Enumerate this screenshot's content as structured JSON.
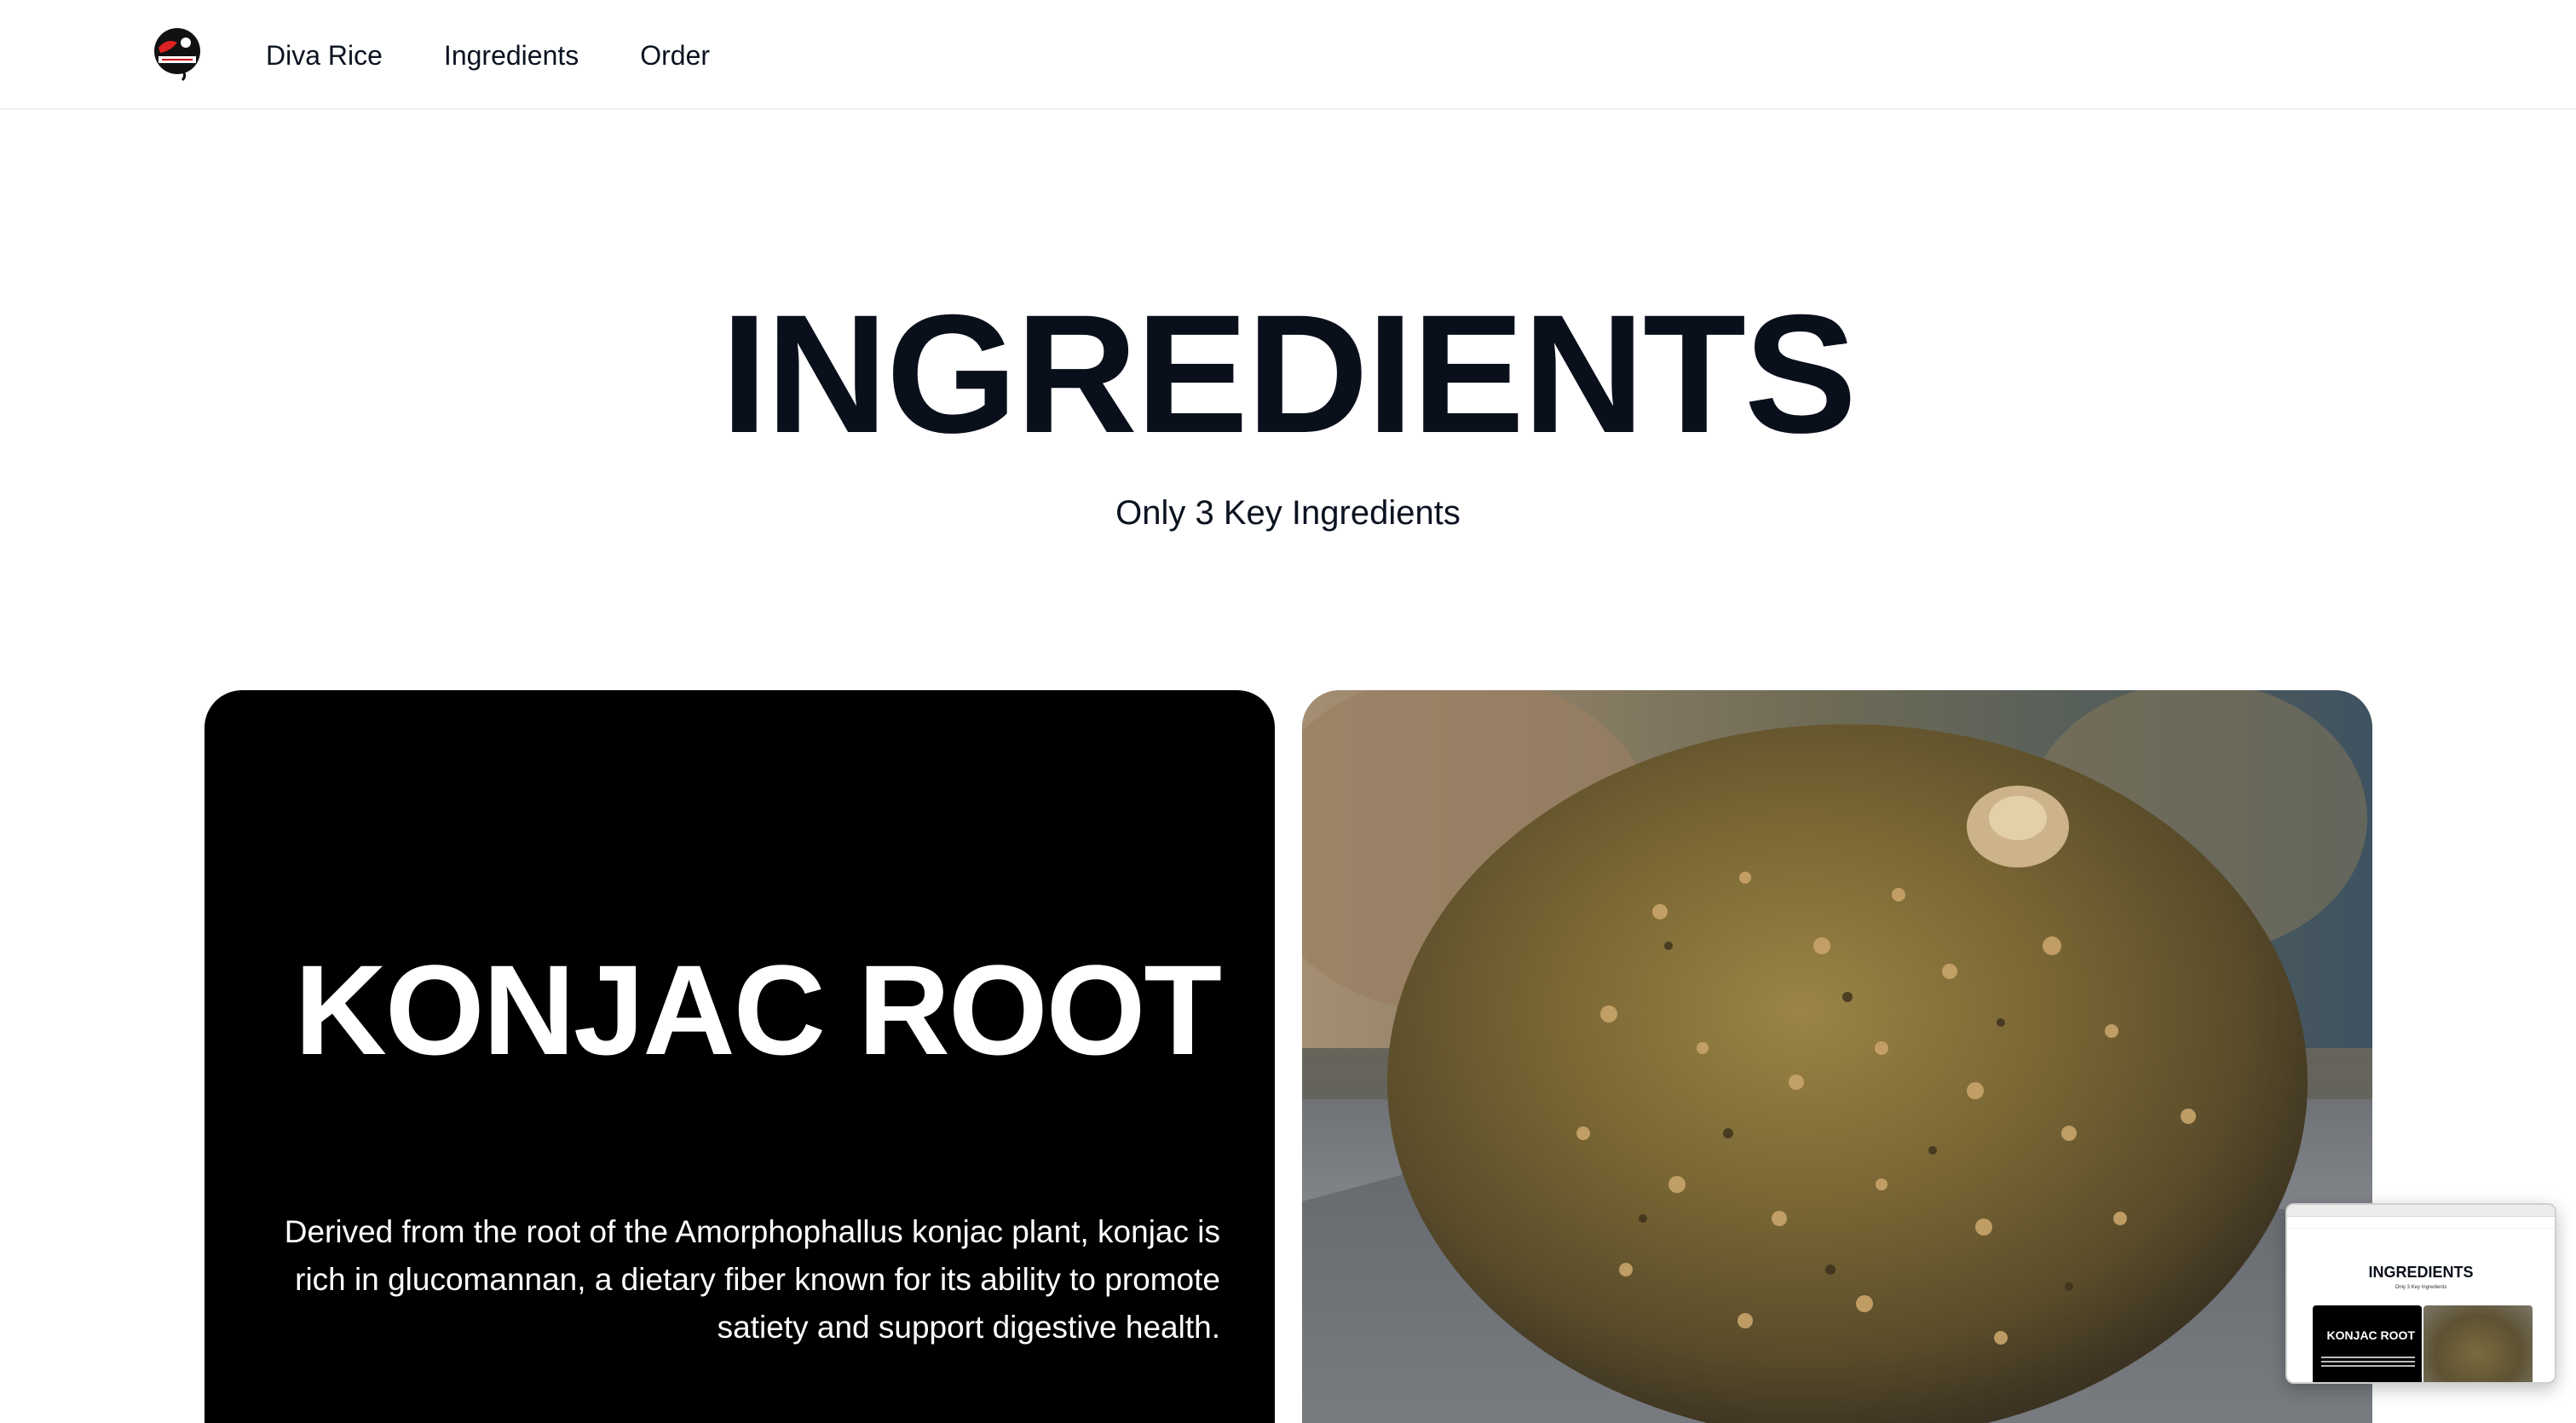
{
  "header": {
    "logo_name": "diva-rice-logo",
    "nav": [
      {
        "label": "Diva Rice"
      },
      {
        "label": "Ingredients"
      },
      {
        "label": "Order"
      }
    ]
  },
  "hero": {
    "title": "INGREDIENTS",
    "subtitle": "Only 3 Key Ingredients"
  },
  "ingredient": {
    "name": "KONJAC ROOT",
    "description": "Derived from the root of the Amorphophallus konjac plant, konjac is rich in glucomannan, a dietary fiber known for its ability to promote satiety and support digestive health.",
    "image_subject": "konjac root"
  },
  "thumbnail": {
    "title": "INGREDIENTS",
    "subtitle": "Only 3 Key Ingredients",
    "card_title": "KONJAC ROOT"
  },
  "colors": {
    "text_dark": "#0a0f1c",
    "card_bg": "#000000",
    "card_text": "#ffffff",
    "page_bg": "#ffffff"
  }
}
